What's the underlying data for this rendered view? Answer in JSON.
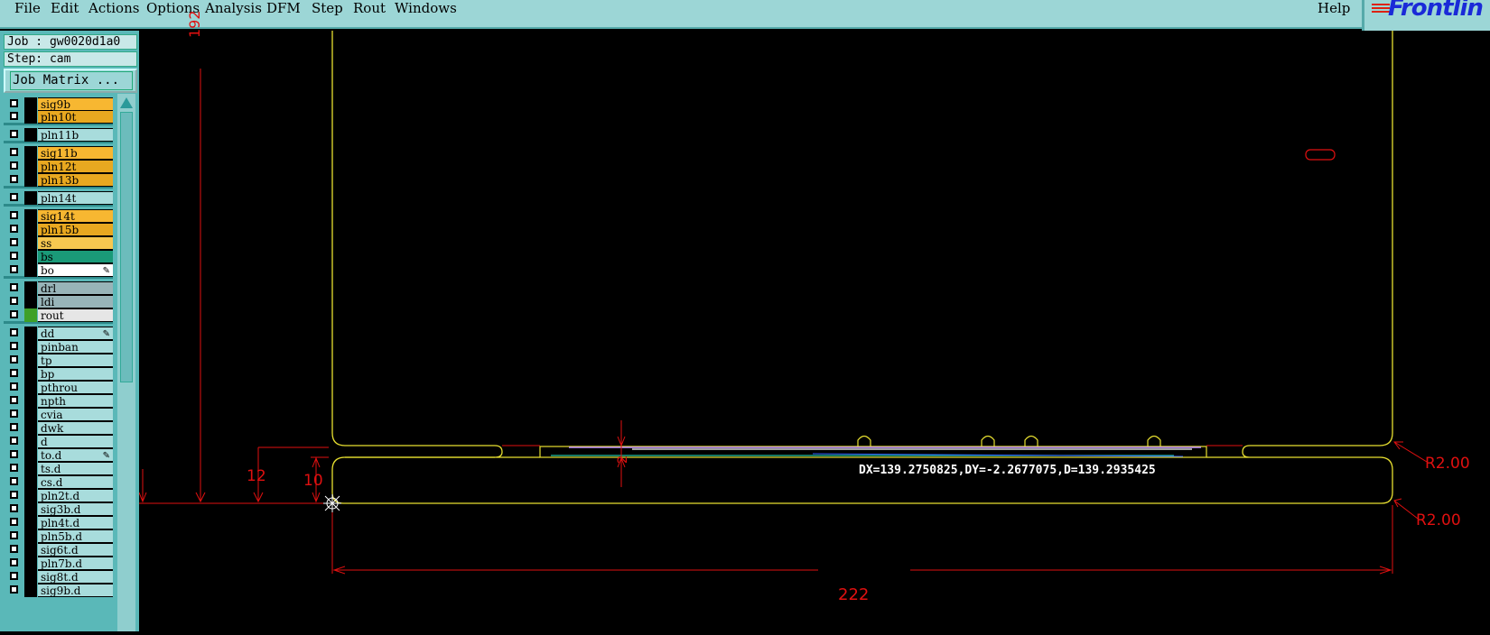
{
  "menu": {
    "items": [
      "File",
      "Edit",
      "Actions",
      "Options",
      "Analysis",
      "DFM",
      "Step",
      "Rout",
      "Windows"
    ],
    "help": "Help"
  },
  "brand": {
    "text": "Frontlin"
  },
  "panel": {
    "job": "Job : gw0020d1a0",
    "step": "Step: cam",
    "job_matrix": "Job Matrix ..."
  },
  "layers": [
    {
      "name": "sig9b",
      "color": "#f7b731",
      "swatch": "#000000"
    },
    {
      "name": "pln10t",
      "color": "#e8a820",
      "swatch": "#000000"
    },
    {
      "name": "pln11b",
      "color": "#a8dcdc",
      "swatch": "#000000"
    },
    {
      "name": "sig11b",
      "color": "#f7b731",
      "swatch": "#000000"
    },
    {
      "name": "pln12t",
      "color": "#e8a820",
      "swatch": "#000000"
    },
    {
      "name": "pln13b",
      "color": "#e8a820",
      "swatch": "#000000"
    },
    {
      "name": "pln14t",
      "color": "#a8dcdc",
      "swatch": "#000000"
    },
    {
      "name": "sig14t",
      "color": "#f7b731",
      "swatch": "#000000"
    },
    {
      "name": "pln15b",
      "color": "#e8a820",
      "swatch": "#000000"
    },
    {
      "name": "ss",
      "color": "#f7c850",
      "swatch": "#000000"
    },
    {
      "name": "bs",
      "color": "#1a9a78",
      "swatch": "#000000"
    },
    {
      "name": "bo",
      "color": "#ffffff",
      "swatch": "#000000",
      "marker": "✎"
    },
    {
      "name": "drl",
      "color": "#98b4b8",
      "swatch": "#000000"
    },
    {
      "name": "ldi",
      "color": "#98b4b8",
      "swatch": "#000000"
    },
    {
      "name": "rout",
      "color": "#e6e6e6",
      "swatch": "#3ea028"
    },
    {
      "name": "dd",
      "color": "#a8dcdc",
      "swatch": "#000000",
      "marker": "✎"
    },
    {
      "name": "pinban",
      "color": "#a8dcdc",
      "swatch": "#000000"
    },
    {
      "name": "tp",
      "color": "#a8dcdc",
      "swatch": "#000000"
    },
    {
      "name": "bp",
      "color": "#a8dcdc",
      "swatch": "#000000"
    },
    {
      "name": "pthrou",
      "color": "#a8dcdc",
      "swatch": "#000000"
    },
    {
      "name": "npth",
      "color": "#a8dcdc",
      "swatch": "#000000"
    },
    {
      "name": "cvia",
      "color": "#a8dcdc",
      "swatch": "#000000"
    },
    {
      "name": "dwk",
      "color": "#a8dcdc",
      "swatch": "#000000"
    },
    {
      "name": "d",
      "color": "#a8dcdc",
      "swatch": "#000000"
    },
    {
      "name": "to.d",
      "color": "#a8dcdc",
      "swatch": "#000000",
      "marker": "✎"
    },
    {
      "name": "ts.d",
      "color": "#a8dcdc",
      "swatch": "#000000"
    },
    {
      "name": "cs.d",
      "color": "#a8dcdc",
      "swatch": "#000000"
    },
    {
      "name": "pln2t.d",
      "color": "#a8dcdc",
      "swatch": "#000000"
    },
    {
      "name": "sig3b.d",
      "color": "#a8dcdc",
      "swatch": "#000000"
    },
    {
      "name": "pln4t.d",
      "color": "#a8dcdc",
      "swatch": "#000000"
    },
    {
      "name": "pln5b.d",
      "color": "#a8dcdc",
      "swatch": "#000000"
    },
    {
      "name": "sig6t.d",
      "color": "#a8dcdc",
      "swatch": "#000000"
    },
    {
      "name": "pln7b.d",
      "color": "#a8dcdc",
      "swatch": "#000000"
    },
    {
      "name": "sig8t.d",
      "color": "#a8dcdc",
      "swatch": "#000000"
    },
    {
      "name": "sig9b.d",
      "color": "#a8dcdc",
      "swatch": "#000000"
    }
  ],
  "canvas": {
    "measurement": "DX=139.2750825,DY=-2.2677075,D=139.2935425",
    "dims": {
      "width": "222",
      "left_12": "12",
      "left_10": "10",
      "top_192": "192",
      "radius_upper": "R2.00",
      "radius_lower": "R2.00",
      "center_2": "2"
    }
  },
  "colors": {
    "outline": "#e8e030",
    "dimension": "#e01010",
    "menu_bg": "#9cd6d6",
    "panel_bg": "#5ab8b8"
  }
}
